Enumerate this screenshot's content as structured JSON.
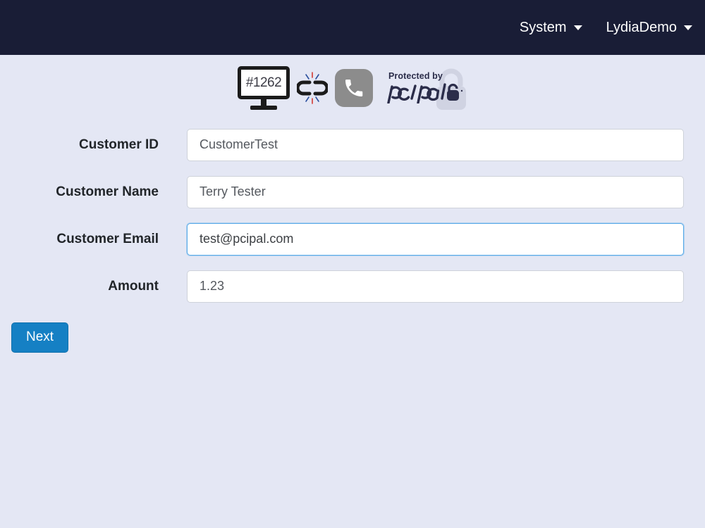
{
  "navbar": {
    "background_color": "#191d36",
    "items": [
      {
        "label": "System",
        "icon": "chevron-down-icon"
      },
      {
        "label": "LydiaDemo",
        "icon": "chevron-down-icon"
      }
    ]
  },
  "status_strip": {
    "session_monitor": {
      "icon": "monitor-icon",
      "session_id": "#1262"
    },
    "connection": {
      "icon": "broken-link-icon",
      "state": "disconnected"
    },
    "call": {
      "icon": "phone-icon",
      "background_color": "#8c8c8c"
    },
    "branding": {
      "protected_by_text": "Protected by",
      "brand_name": "pcipal",
      "icon": "padlock-icon"
    }
  },
  "form": {
    "fields": [
      {
        "label": "Customer ID",
        "value": "CustomerTest",
        "placeholder": "",
        "focused": false,
        "name": "customer-id"
      },
      {
        "label": "Customer Name",
        "value": "Terry Tester",
        "placeholder": "",
        "focused": false,
        "name": "customer-name"
      },
      {
        "label": "Customer Email",
        "value": "test@pcipal.com",
        "placeholder": "",
        "focused": true,
        "name": "customer-email"
      },
      {
        "label": "Amount",
        "value": "1.23",
        "placeholder": "",
        "focused": false,
        "name": "amount"
      }
    ],
    "submit_label": "Next",
    "submit_color": "#1580c4"
  },
  "theme": {
    "page_background": "#e4e7f4",
    "accent_blue": "#1580c4",
    "focus_border": "#5aabe8",
    "label_color": "#212529"
  }
}
